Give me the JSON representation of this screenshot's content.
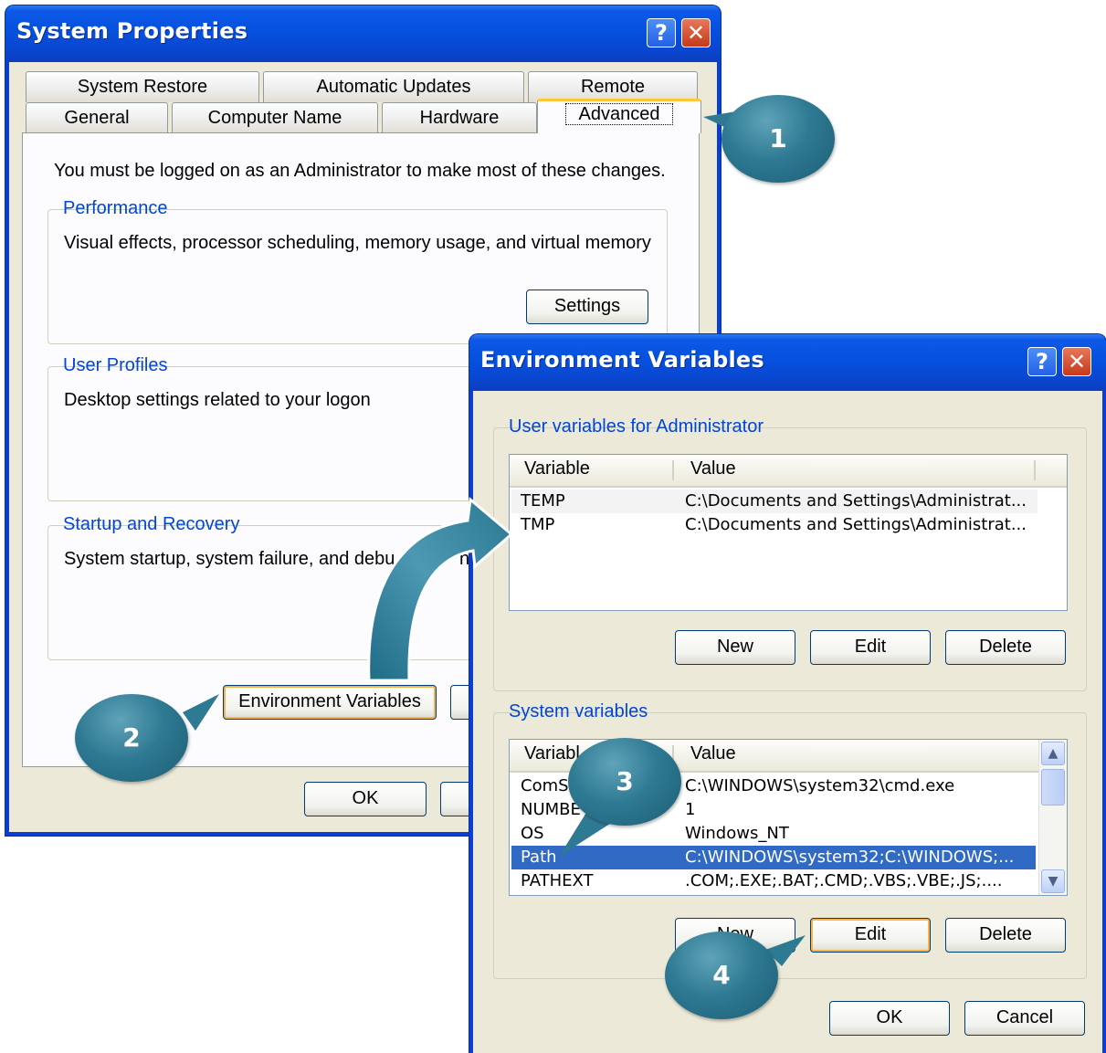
{
  "system_properties": {
    "title": "System Properties",
    "help_glyph": "?",
    "close_glyph": "✕",
    "tabs_row1": [
      "System Restore",
      "Automatic Updates",
      "Remote"
    ],
    "tabs_row2": [
      "General",
      "Computer Name",
      "Hardware",
      "Advanced"
    ],
    "admin_notice": "You must be logged on as an Administrator to make most of these changes.",
    "performance": {
      "label": "Performance",
      "description": "Visual effects, processor scheduling, memory usage, and virtual memory",
      "settings_button": "Settings"
    },
    "user_profiles": {
      "label": "User Profiles",
      "description": "Desktop settings related to your logon"
    },
    "startup_recovery": {
      "label": "Startup and Recovery",
      "description": "System startup, system failure, and debu",
      "description_tail": "nfor"
    },
    "env_vars_button": "Environment Variables",
    "ok_button": "OK"
  },
  "environment_variables": {
    "title": "Environment Variables",
    "help_glyph": "?",
    "close_glyph": "✕",
    "user_group_label": "User variables for Administrator",
    "columns": [
      "Variable",
      "Value"
    ],
    "user_rows": [
      {
        "variable": "TEMP",
        "value": "C:\\Documents and Settings\\Administrat..."
      },
      {
        "variable": "TMP",
        "value": "C:\\Documents and Settings\\Administrat..."
      }
    ],
    "user_buttons": {
      "new": "New",
      "edit": "Edit",
      "delete": "Delete"
    },
    "system_group_label": "System variables",
    "system_columns": [
      "Variabl",
      "Value"
    ],
    "system_rows": [
      {
        "variable": "ComS",
        "value": "C:\\WINDOWS\\system32\\cmd.exe"
      },
      {
        "variable": "NUMBE",
        "value": "1"
      },
      {
        "variable": "OS",
        "value": "Windows_NT"
      },
      {
        "variable": "Path",
        "value": "C:\\WINDOWS\\system32;C:\\WINDOWS;..."
      },
      {
        "variable": "PATHEXT",
        "value": ".COM;.EXE;.BAT;.CMD;.VBS;.VBE;.JS;...."
      }
    ],
    "system_buttons": {
      "new": "New",
      "edit": "Edit",
      "delete": "Delete"
    },
    "ok_button": "OK",
    "cancel_button": "Cancel"
  },
  "callouts": [
    "1",
    "2",
    "3",
    "4"
  ],
  "colors": {
    "xp_title_blue": "#0551de",
    "group_label_blue": "#0046d5",
    "selection_blue": "#316ac5",
    "callout_teal": "#2f7a93"
  }
}
